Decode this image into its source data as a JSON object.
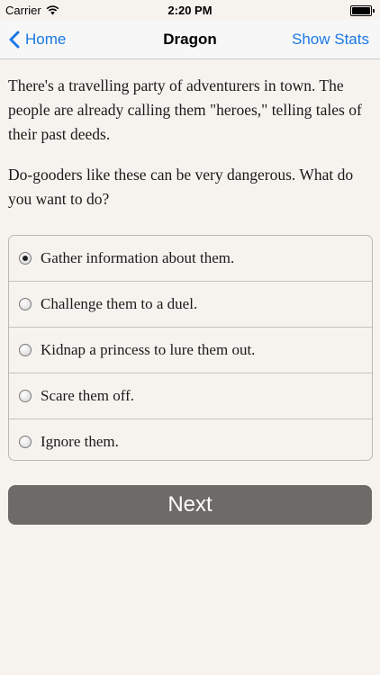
{
  "status_bar": {
    "carrier": "Carrier",
    "time": "2:20 PM"
  },
  "nav": {
    "back_label": "Home",
    "title": "Dragon",
    "right_label": "Show Stats"
  },
  "story": {
    "paragraphs": [
      "There's a travelling party of adventurers in town. The people are already calling them \"heroes,\" telling tales of their past deeds.",
      "Do-gooders like these can be very dangerous. What do you want to do?"
    ]
  },
  "choices": [
    {
      "label": "Gather information about them.",
      "selected": true
    },
    {
      "label": "Challenge them to a duel.",
      "selected": false
    },
    {
      "label": "Kidnap a princess to lure them out.",
      "selected": false
    },
    {
      "label": "Scare them off.",
      "selected": false
    },
    {
      "label": "Ignore them.",
      "selected": false
    }
  ],
  "next_label": "Next",
  "colors": {
    "accent": "#1a78e6",
    "button": "#6d6a67",
    "background": "#f6f3ef"
  }
}
